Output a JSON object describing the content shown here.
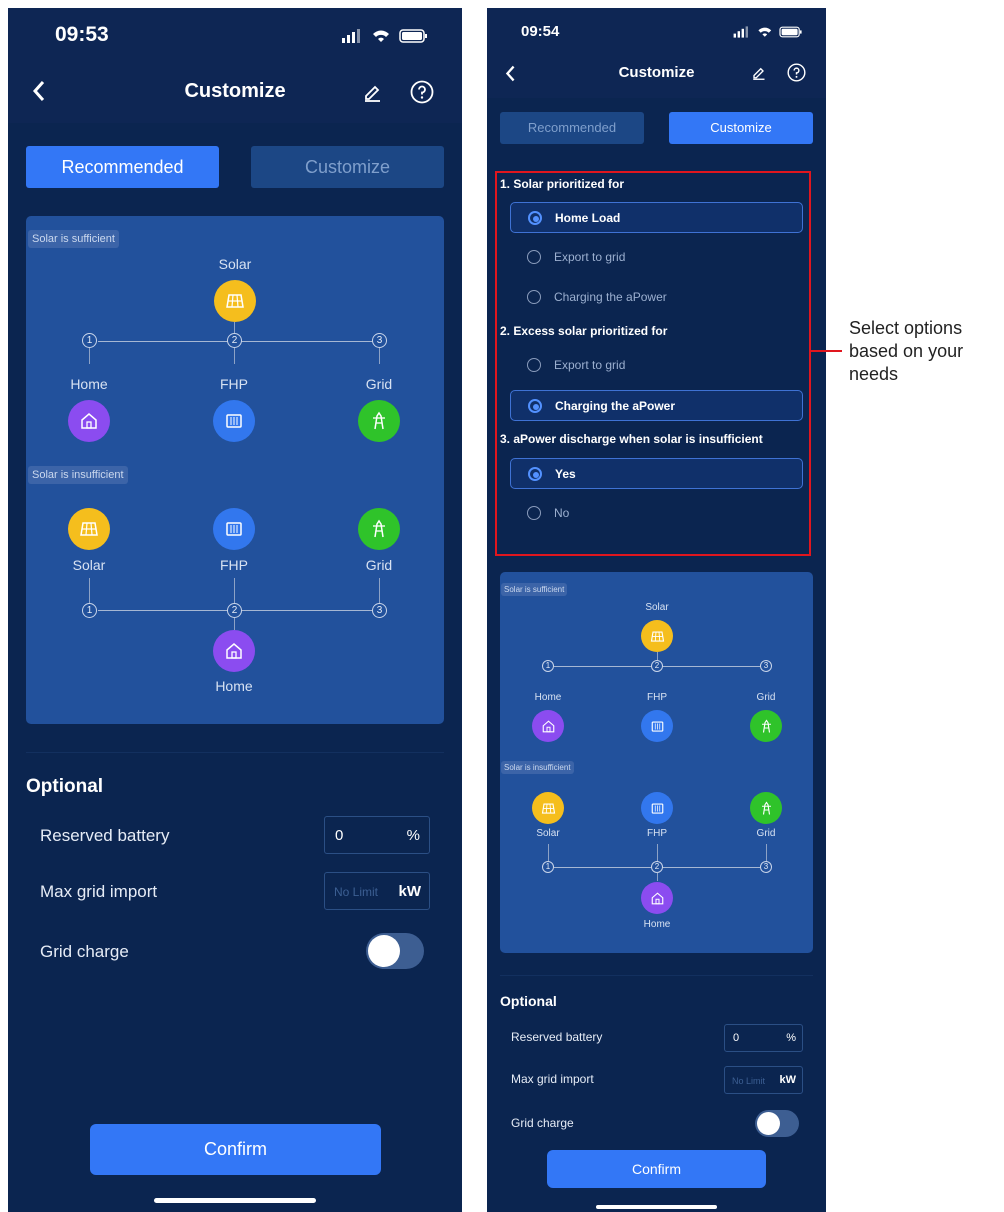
{
  "left_phone": {
    "time": "09:53",
    "title": "Customize",
    "tabs": [
      "Recommended",
      "Customize"
    ],
    "diagram": {
      "sufficient_chip": "Solar is sufficient",
      "insufficient_chip": "Solar is insufficient",
      "solar": "Solar",
      "home": "Home",
      "fhp": "FHP",
      "grid": "Grid",
      "n1": "1",
      "n2": "2",
      "n3": "3"
    },
    "optional": {
      "heading": "Optional",
      "reserved_label": "Reserved battery",
      "reserved_value": "0",
      "reserved_unit": "%",
      "max_import_label": "Max grid import",
      "max_import_placeholder": "No Limit",
      "max_import_unit": "kW",
      "grid_charge_label": "Grid charge",
      "grid_charge_on": false
    },
    "confirm": "Confirm"
  },
  "right_phone": {
    "time": "09:54",
    "title": "Customize",
    "tabs": [
      "Recommended",
      "Customize"
    ],
    "questions": [
      {
        "title": "1. Solar prioritized for",
        "options": [
          "Home Load",
          "Export to grid",
          "Charging the aPower"
        ],
        "selected": 0
      },
      {
        "title": "2. Excess solar prioritized for",
        "options": [
          "Export to grid",
          "Charging the aPower"
        ],
        "selected": 1
      },
      {
        "title": "3. aPower discharge when solar is insufficient",
        "options": [
          "Yes",
          "No"
        ],
        "selected": 0
      }
    ],
    "diagram": {
      "sufficient_chip": "Solar is sufficient",
      "insufficient_chip": "Solar is insufficient",
      "solar": "Solar",
      "home": "Home",
      "fhp": "FHP",
      "grid": "Grid",
      "n1": "1",
      "n2": "2",
      "n3": "3"
    },
    "optional": {
      "heading": "Optional",
      "reserved_label": "Reserved battery",
      "reserved_value": "0",
      "reserved_unit": "%",
      "max_import_label": "Max grid import",
      "max_import_placeholder": "No Limit",
      "max_import_unit": "kW",
      "grid_charge_label": "Grid charge",
      "grid_charge_on": false
    },
    "confirm": "Confirm"
  },
  "annotation": {
    "lines": [
      "Select options",
      "based on your",
      "needs"
    ],
    "highlight_color": "#e0161e"
  },
  "colors": {
    "background": "#0b2550",
    "accent": "#3377f6",
    "solar": "#f5be1d",
    "home": "#8b4cf0",
    "fhp": "#3277ee",
    "grid": "#2fc32a"
  }
}
